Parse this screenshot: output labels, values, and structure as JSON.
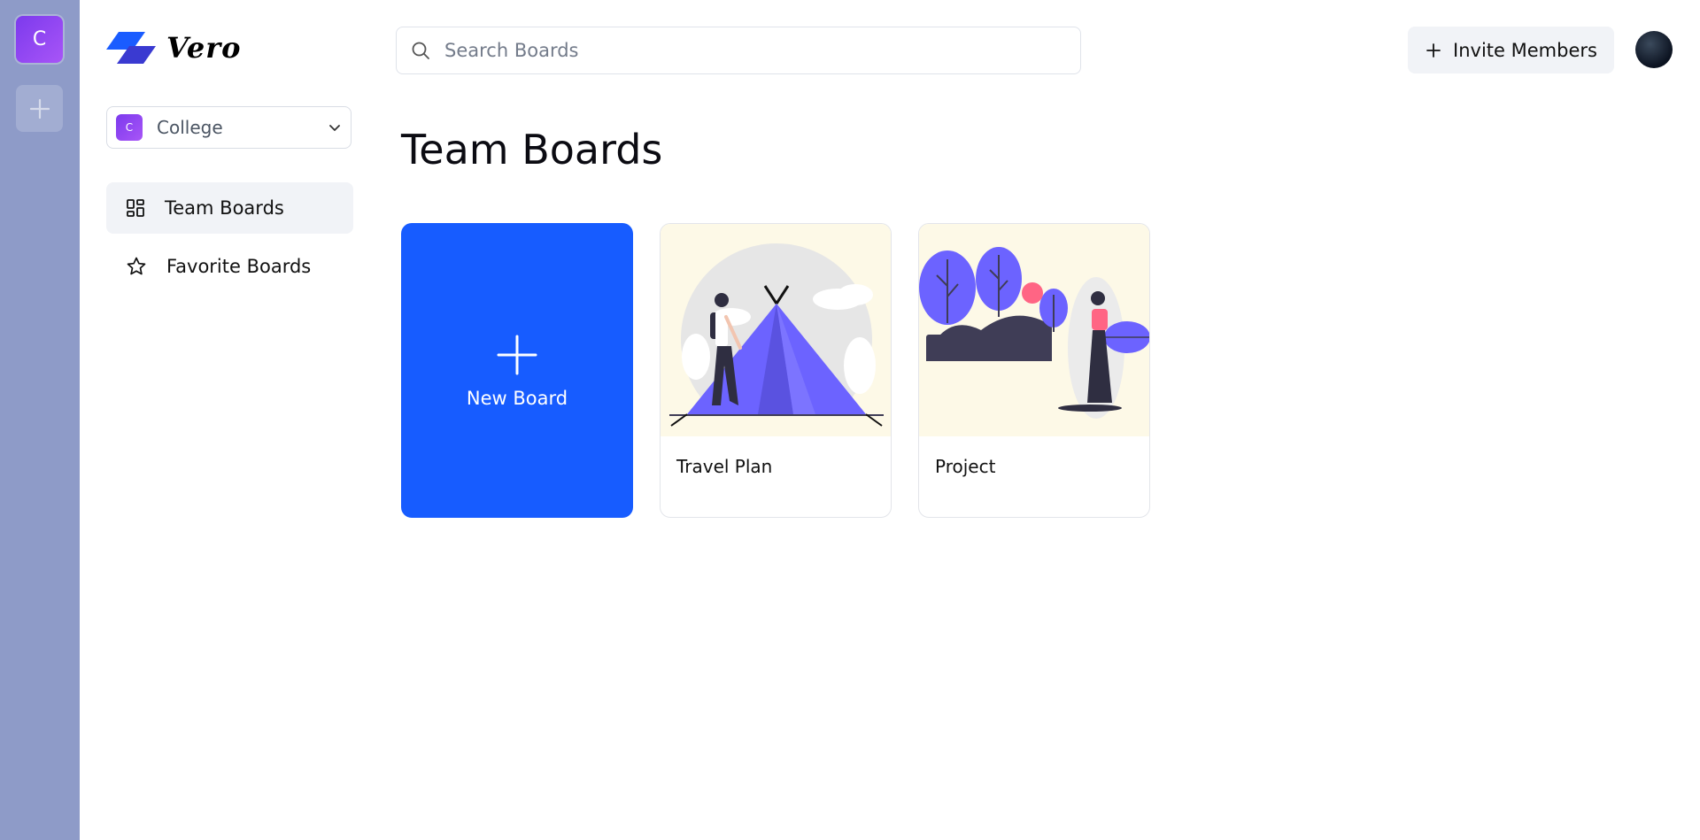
{
  "app": {
    "name": "Vero"
  },
  "rail": {
    "org_initial": "C"
  },
  "sidebar": {
    "org": {
      "initial": "C",
      "name": "College"
    },
    "items": [
      {
        "label": "Team Boards",
        "active": true
      },
      {
        "label": "Favorite Boards",
        "active": false
      }
    ]
  },
  "topbar": {
    "search_placeholder": "Search Boards",
    "invite_label": "Invite Members"
  },
  "main": {
    "title": "Team Boards",
    "new_board_label": "New Board",
    "boards": [
      {
        "title": "Travel Plan",
        "illustration": "camping-tent"
      },
      {
        "title": "Project",
        "illustration": "trees-person"
      }
    ]
  },
  "colors": {
    "rail": "#8e9bc8",
    "accent": "#175cff",
    "org_gradient": [
      "#7c3aed",
      "#a855f7"
    ],
    "illustration_purple": "#6c63ff"
  }
}
